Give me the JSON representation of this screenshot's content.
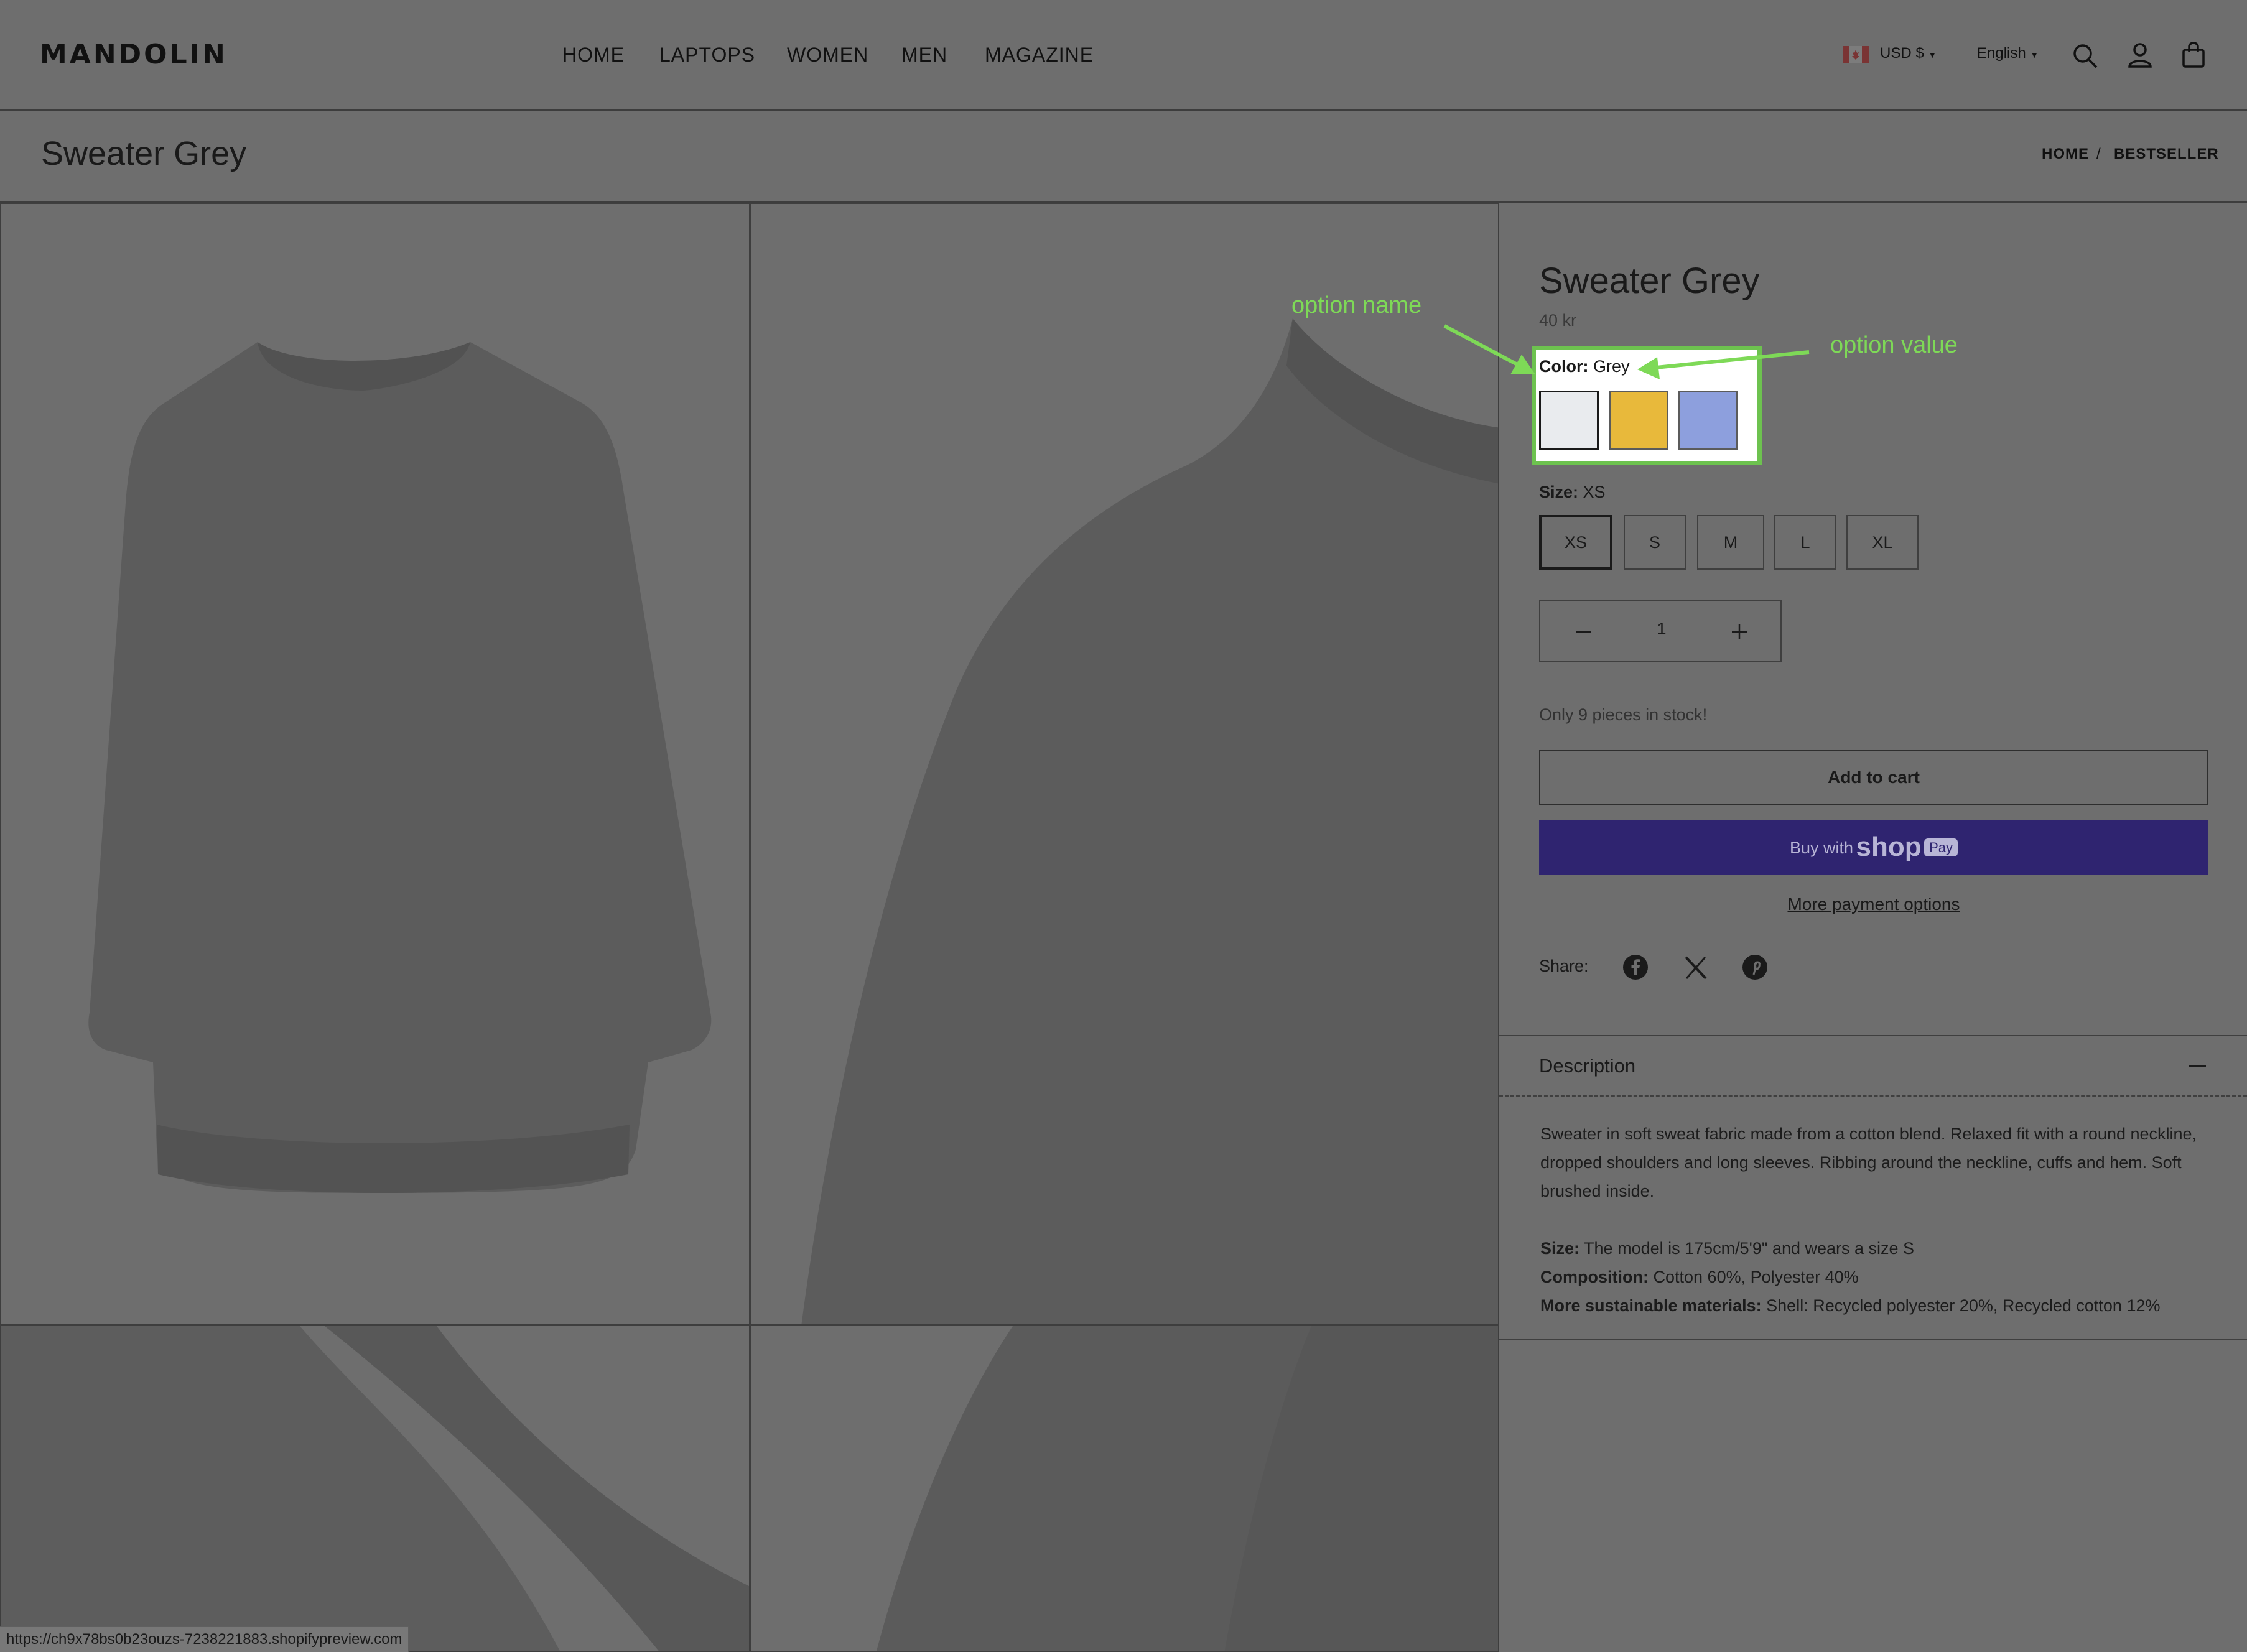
{
  "header": {
    "logo": "MANDOLIN",
    "nav": [
      "HOME",
      "LAPTOPS",
      "WOMEN",
      "MEN",
      "MAGAZINE"
    ],
    "currency": "USD $",
    "language": "English"
  },
  "title_bar": {
    "title": "Sweater Grey",
    "breadcrumb": [
      "HOME",
      "/",
      "BESTSELLER"
    ]
  },
  "product": {
    "name": "Sweater Grey",
    "price": "40 kr",
    "color_label": "Color:",
    "color_value": "Grey",
    "swatches": [
      {
        "name": "Grey",
        "color": "#e9ebee"
      },
      {
        "name": "Yellow",
        "color": "#e8b93b"
      },
      {
        "name": "Blue",
        "color": "#8d9fdd"
      }
    ],
    "size_label": "Size:",
    "size_value": "XS",
    "sizes": [
      "XS",
      "S",
      "M",
      "L",
      "XL"
    ],
    "quantity": "1",
    "stock_note": "Only 9 pieces in stock!",
    "add_to_cart": "Add to cart",
    "buy_with": "Buy with",
    "shop_word": "shop",
    "pay_badge": "Pay",
    "more_payment": "More payment options",
    "share_label": "Share:"
  },
  "description": {
    "heading": "Description",
    "paragraph": "Sweater in soft sweat fabric made from a cotton blend. Relaxed fit with a round neckline, dropped shoulders and long sleeves. Ribbing around the neckline, cuffs and hem. Soft brushed inside.",
    "specs": [
      {
        "label": "Size:",
        "value": "The model is 175cm/5'9\" and wears a size S"
      },
      {
        "label": "Composition:",
        "value": "Cotton 60%, Polyester 40%"
      },
      {
        "label": "More sustainable materials:",
        "value": "Shell: Recycled polyester 20%, Recycled cotton 12%"
      }
    ]
  },
  "annotations": {
    "option_name": "option name",
    "option_value": "option value",
    "color": "#7ed957"
  },
  "status_url": "https://ch9x78bs0b23ouzs-7238221883.shopifypreview.com",
  "colors": {
    "overlay": "#6e6e6e",
    "shop_pay": "#2f2470",
    "highlight": "#6dc24f"
  }
}
